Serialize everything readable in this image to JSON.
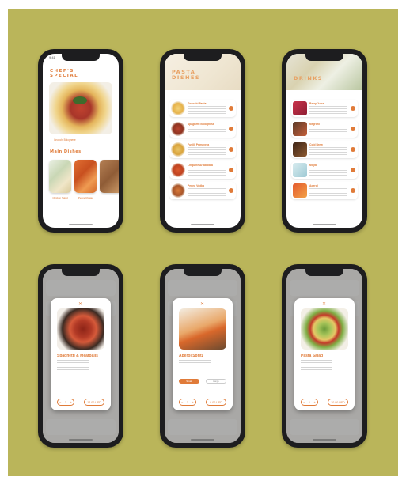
{
  "phone1": {
    "title": "CHEF'S SPECIAL",
    "hero_caption": "Gnocchi Bolognese",
    "section": "Main Dishes",
    "cards": [
      {
        "label": "Chicken Salad"
      },
      {
        "label": "Penne Rigate"
      }
    ]
  },
  "phone2": {
    "title": "PASTA DISHES",
    "items": [
      {
        "name": "Gnocchi Pasta"
      },
      {
        "name": "Spaghetti Bolognese"
      },
      {
        "name": "Fusilli Primavera"
      },
      {
        "name": "Linguine Arrabbiata"
      },
      {
        "name": "Penne Vodka"
      }
    ]
  },
  "phone3": {
    "title": "DRINKS",
    "items": [
      {
        "name": "Berry Juice"
      },
      {
        "name": "Negroni"
      },
      {
        "name": "Cold Brew"
      },
      {
        "name": "Mojito"
      },
      {
        "name": "Aperol"
      }
    ]
  },
  "phone4": {
    "dish": "Spaghetti & Meatballs",
    "qty": "1",
    "price": "12.00 USD"
  },
  "phone5": {
    "dish": "Aperol Spritz",
    "option1": "Small",
    "option2": "Large",
    "qty": "1",
    "price": "8.00 USD"
  },
  "phone6": {
    "dish": "Pasta Salad",
    "qty": "1",
    "price": "10.00 USD"
  },
  "status": {
    "time": "9:41"
  },
  "colors": {
    "accent": "#e07b39",
    "board": "#bab55a",
    "frame": "#1d1d1f"
  }
}
